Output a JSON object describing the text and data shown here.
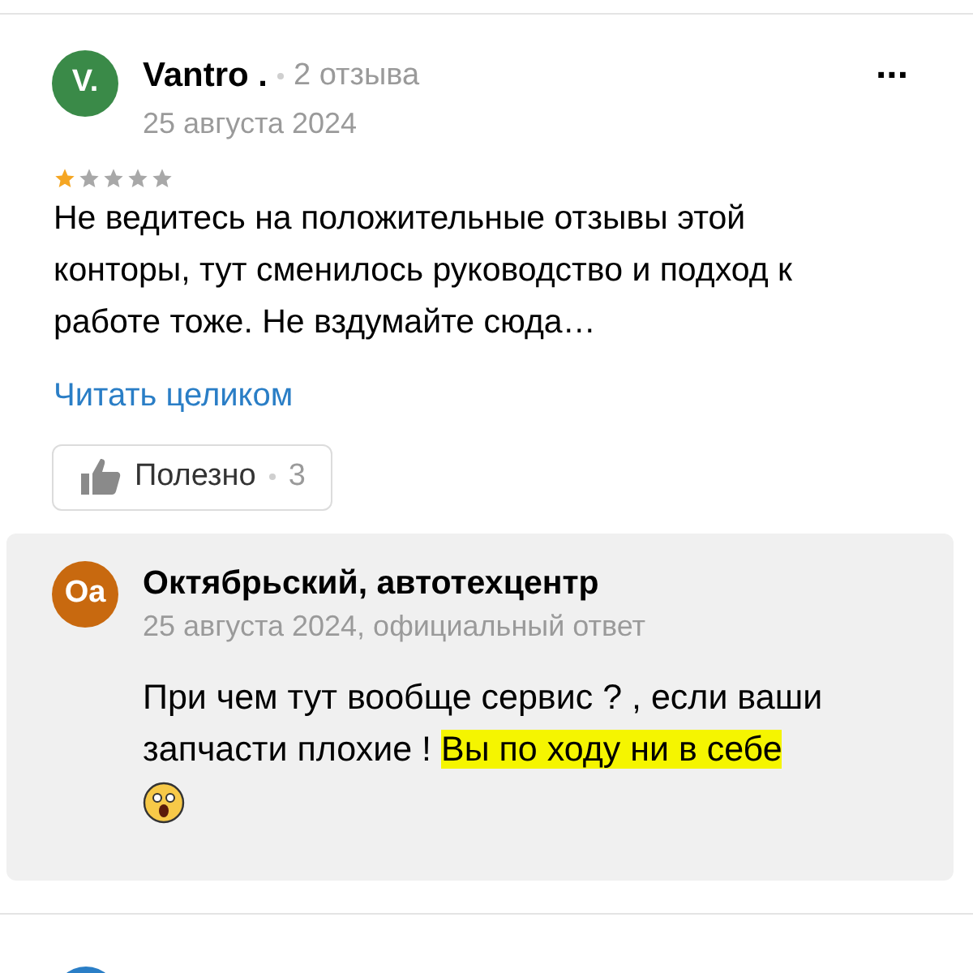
{
  "review": {
    "avatar_initials": "V.",
    "author": "Vantro .",
    "reviews_count": "2 отзыва",
    "date": "25 августа 2024",
    "more": "...",
    "stars": 1,
    "text": "Не ведитесь на положительные отзывы этой конторы, тут сменилось руководство и подход к работе тоже. Не вздумайте сюда…",
    "read_more": "Читать целиком",
    "useful": {
      "label": "Полезно",
      "count": "3"
    }
  },
  "reply": {
    "avatar_initials": "Oa",
    "author": "Октябрьский, автотехцентр",
    "date_line": "25 августа 2024, официальный ответ",
    "segments": [
      {
        "text": "При чем тут вообще сервис ? , если ваши запчасти плохие ! ",
        "highlighted": false
      },
      {
        "text": "Вы по ходу ни в себе ",
        "highlighted": true
      }
    ]
  }
}
